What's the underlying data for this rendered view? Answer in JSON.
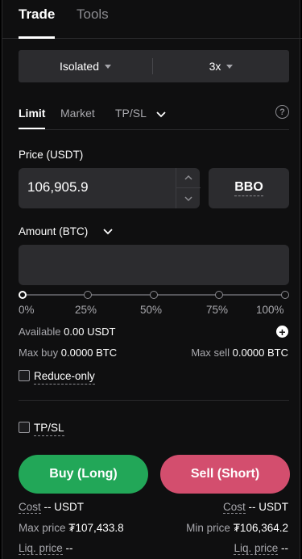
{
  "tabs": [
    "Trade",
    "Tools"
  ],
  "margin": {
    "mode": "Isolated",
    "leverage": "3x"
  },
  "order_types": [
    "Limit",
    "Market",
    "TP/SL"
  ],
  "price": {
    "label": "Price (USDT)",
    "value": "106,905.9",
    "bbo_label": "BBO"
  },
  "amount": {
    "label": "Amount (BTC)",
    "value": ""
  },
  "slider": {
    "marks": [
      "0%",
      "25%",
      "50%",
      "75%",
      "100%"
    ],
    "value_pct": 0
  },
  "available": {
    "label": "Available",
    "value": "0.00 USDT"
  },
  "max_buy": {
    "label": "Max buy",
    "value": "0.0000 BTC"
  },
  "max_sell": {
    "label": "Max sell",
    "value": "0.0000 BTC"
  },
  "reduce_only": "Reduce-only",
  "tpsl": "TP/SL",
  "buttons": {
    "buy": "Buy (Long)",
    "sell": "Sell (Short)"
  },
  "buy_info": {
    "cost_label": "Cost",
    "cost": "-- USDT",
    "max_price_label": "Max price",
    "max_price": "₮107,433.8",
    "liq_label": "Liq. price",
    "liq": "--"
  },
  "sell_info": {
    "cost_label": "Cost",
    "cost": "-- USDT",
    "min_price_label": "Min price",
    "min_price": "₮106,364.2",
    "liq_label": "Liq. price",
    "liq": "--"
  },
  "colors": {
    "buy": "#22a758",
    "sell": "#d34e6e",
    "panel": "#0f0f10",
    "input": "#2c2c2f"
  }
}
